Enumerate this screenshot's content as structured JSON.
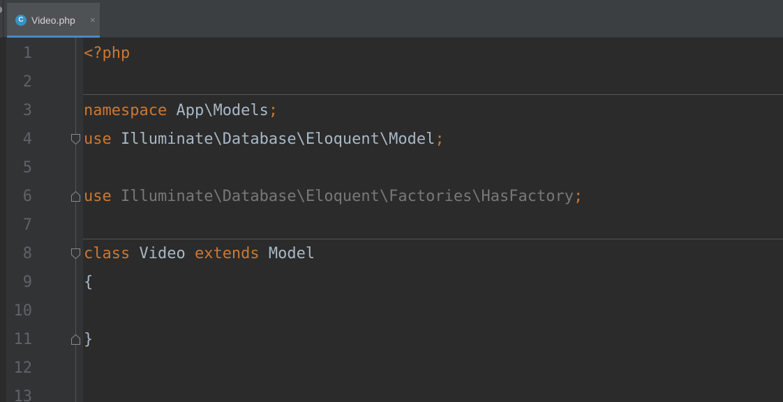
{
  "tab": {
    "label": "Video.php",
    "icon": "php-class-icon",
    "icon_letter": "C",
    "close": "×"
  },
  "editor": {
    "lines": [
      {
        "number": "1",
        "tokens": [
          {
            "text": "<?php",
            "kind": "kw"
          }
        ]
      },
      {
        "number": "2",
        "tokens": []
      },
      {
        "number": "3",
        "tokens": [
          {
            "text": "namespace",
            "kind": "kw"
          },
          {
            "text": " App\\Models",
            "kind": "id"
          },
          {
            "text": ";",
            "kind": "kw"
          }
        ]
      },
      {
        "number": "4",
        "fold": "open",
        "tokens": [
          {
            "text": "use",
            "kind": "kw"
          },
          {
            "text": " Illuminate\\Database\\Eloquent\\Model",
            "kind": "id"
          },
          {
            "text": ";",
            "kind": "kw"
          }
        ]
      },
      {
        "number": "5",
        "tokens": []
      },
      {
        "number": "6",
        "fold": "close",
        "tokens": [
          {
            "text": "use",
            "kind": "kw"
          },
          {
            "text": " Illuminate\\Database\\Eloquent\\Factories\\HasFactory",
            "kind": "dim"
          },
          {
            "text": ";",
            "kind": "kw"
          }
        ]
      },
      {
        "number": "7",
        "tokens": []
      },
      {
        "number": "8",
        "fold": "open",
        "tokens": [
          {
            "text": "class",
            "kind": "kw"
          },
          {
            "text": " Video ",
            "kind": "id"
          },
          {
            "text": "extends",
            "kind": "kw"
          },
          {
            "text": " Model",
            "kind": "id"
          }
        ]
      },
      {
        "number": "9",
        "tokens": [
          {
            "text": "{",
            "kind": "id"
          }
        ]
      },
      {
        "number": "10",
        "tokens": []
      },
      {
        "number": "11",
        "fold": "close",
        "tokens": [
          {
            "text": "}",
            "kind": "id"
          }
        ]
      },
      {
        "number": "12",
        "tokens": []
      },
      {
        "number": "13",
        "tokens": []
      }
    ]
  },
  "colors": {
    "background": "#2b2b2b",
    "gutter": "#313335",
    "keyword": "#cc7832",
    "identifier": "#a9b7c6",
    "unused": "#787878",
    "line_number": "#606366",
    "tab_accent": "#4a88c7"
  }
}
